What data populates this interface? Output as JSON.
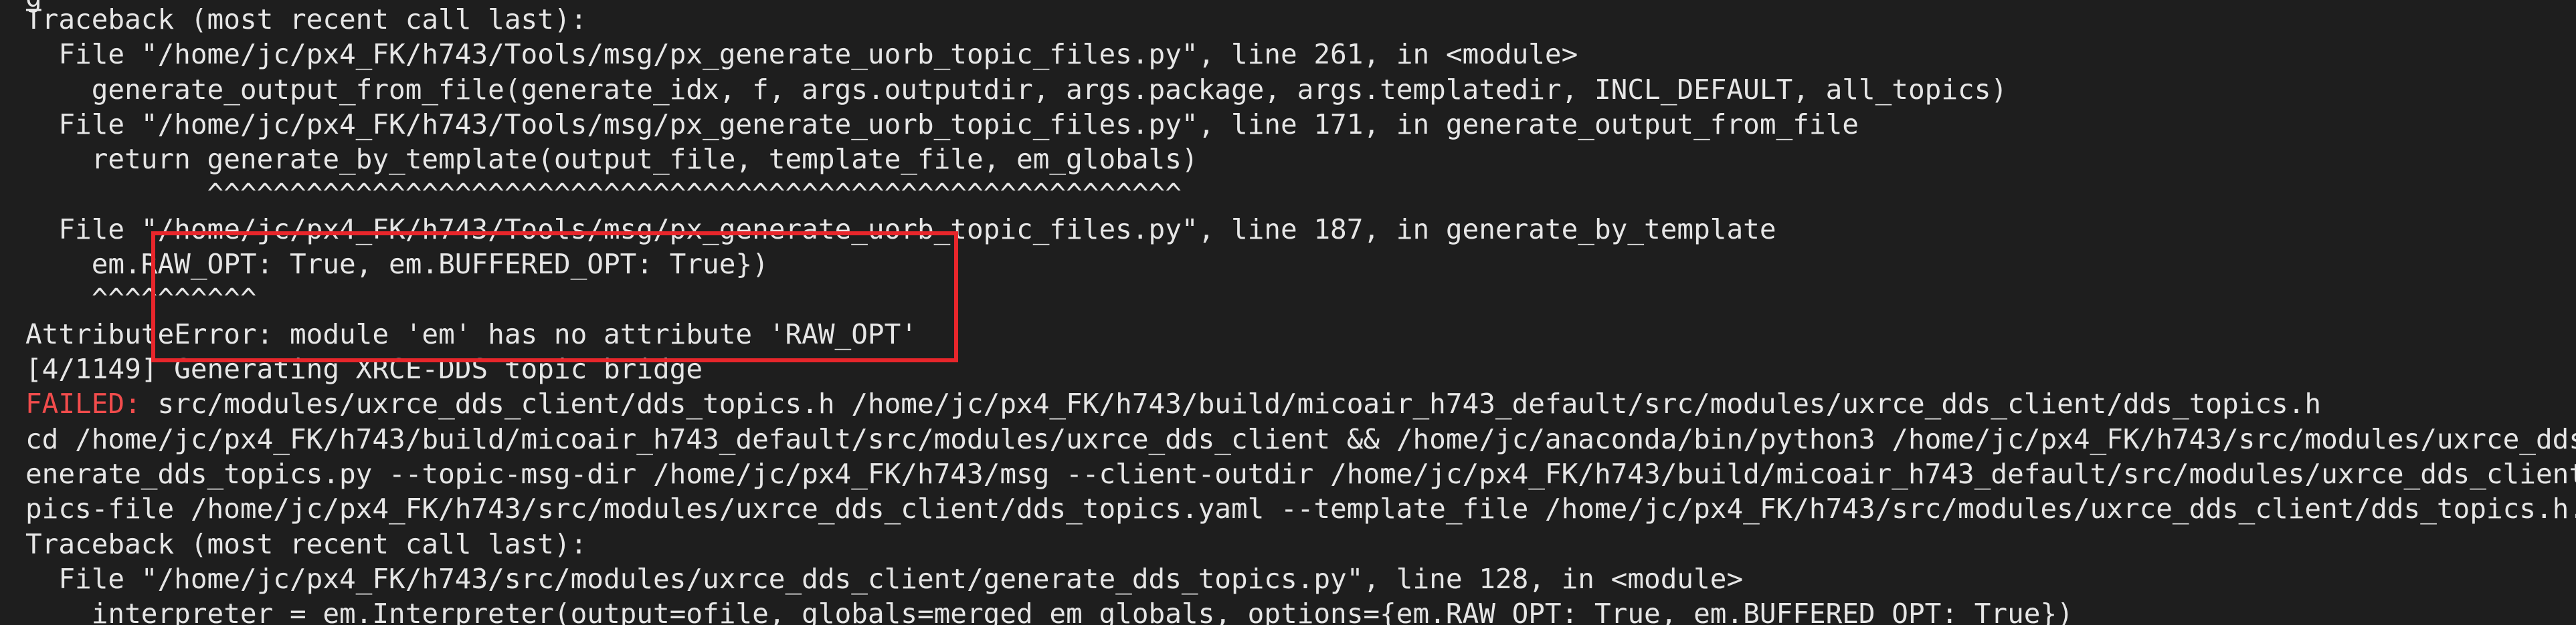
{
  "terminal": {
    "lines": [
      {
        "text": "g",
        "kind": "normal"
      },
      {
        "text": "Traceback (most recent call last):",
        "kind": "normal"
      },
      {
        "text": "  File \"/home/jc/px4_FK/h743/Tools/msg/px_generate_uorb_topic_files.py\", line 261, in <module>",
        "kind": "normal"
      },
      {
        "text": "    generate_output_from_file(generate_idx, f, args.outputdir, args.package, args.templatedir, INCL_DEFAULT, all_topics)",
        "kind": "normal"
      },
      {
        "text": "  File \"/home/jc/px4_FK/h743/Tools/msg/px_generate_uorb_topic_files.py\", line 171, in generate_output_from_file",
        "kind": "normal"
      },
      {
        "text": "    return generate_by_template(output_file, template_file, em_globals)",
        "kind": "normal"
      },
      {
        "text": "           ^^^^^^^^^^^^^^^^^^^^^^^^^^^^^^^^^^^^^^^^^^^^^^^^^^^^^^^^^^^",
        "kind": "normal"
      },
      {
        "text": "  File \"/home/jc/px4_FK/h743/Tools/msg/px_generate_uorb_topic_files.py\", line 187, in generate_by_template",
        "kind": "normal"
      },
      {
        "text": "    em.RAW_OPT: True, em.BUFFERED_OPT: True})",
        "kind": "normal"
      },
      {
        "text": "    ^^^^^^^^^^",
        "kind": "normal"
      },
      {
        "text": "AttributeError: module 'em' has no attribute 'RAW_OPT'",
        "kind": "normal"
      },
      {
        "text": "[4/1149] Generating XRCE-DDS topic bridge",
        "kind": "normal"
      },
      {
        "prefix": "FAILED:",
        "text": " src/modules/uxrce_dds_client/dds_topics.h /home/jc/px4_FK/h743/build/micoair_h743_default/src/modules/uxrce_dds_client/dds_topics.h",
        "kind": "failed"
      },
      {
        "text": "cd /home/jc/px4_FK/h743/build/micoair_h743_default/src/modules/uxrce_dds_client && /home/jc/anaconda/bin/python3 /home/jc/px4_FK/h743/src/modules/uxrce_dds_client/g",
        "kind": "normal"
      },
      {
        "text": "enerate_dds_topics.py --topic-msg-dir /home/jc/px4_FK/h743/msg --client-outdir /home/jc/px4_FK/h743/build/micoair_h743_default/src/modules/uxrce_dds_client --dds-to",
        "kind": "normal"
      },
      {
        "text": "pics-file /home/jc/px4_FK/h743/src/modules/uxrce_dds_client/dds_topics.yaml --template_file /home/jc/px4_FK/h743/src/modules/uxrce_dds_client/dds_topics.h.em",
        "kind": "normal"
      },
      {
        "text": "Traceback (most recent call last):",
        "kind": "normal"
      },
      {
        "text": "  File \"/home/jc/px4_FK/h743/src/modules/uxrce_dds_client/generate_dds_topics.py\", line 128, in <module>",
        "kind": "normal"
      },
      {
        "text": "    interpreter = em.Interpreter(output=ofile, globals=merged_em_globals, options={em.RAW_OPT: True, em.BUFFERED_OPT: True})",
        "kind": "normal"
      }
    ]
  },
  "colors": {
    "background": "#1e1e1e",
    "text": "#e6e6e6",
    "failed": "#f14c4c",
    "highlight_box": "#e8262b"
  }
}
